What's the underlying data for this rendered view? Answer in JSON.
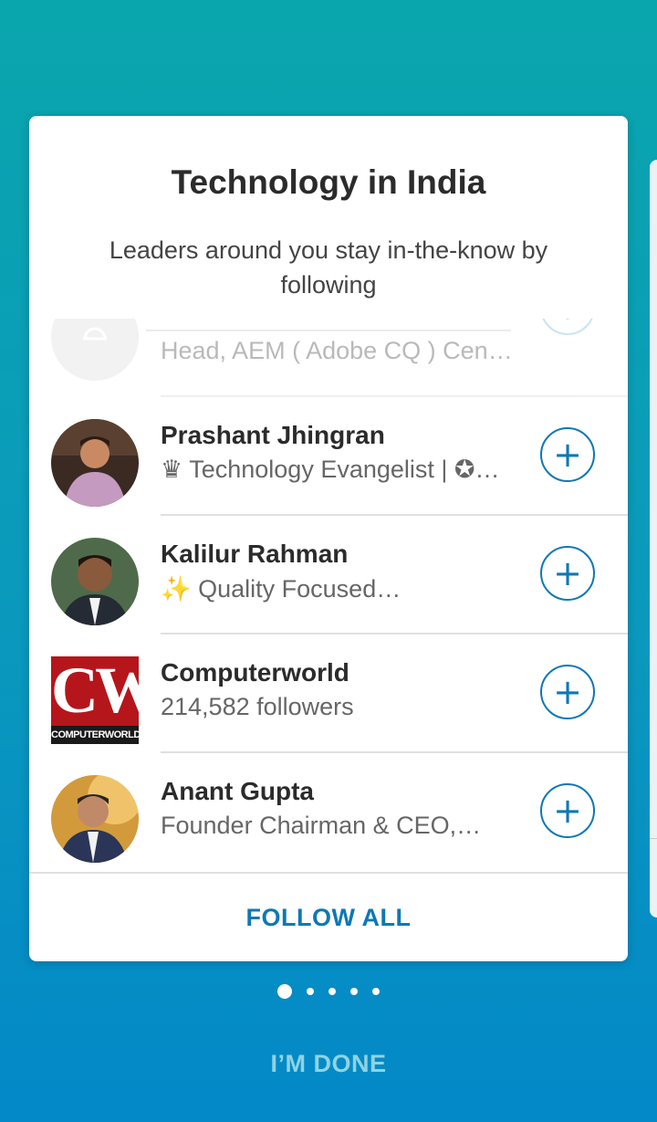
{
  "header": {
    "title": "Technology in India",
    "subtitle": "Leaders around you stay in-the-know by following"
  },
  "people": [
    {
      "name": "",
      "detail": "Head, AEM ( Adobe CQ ) Cent…",
      "avatar": "placeholder-avatar",
      "follow_icon": "+"
    },
    {
      "name": "Prashant Jhingran",
      "detail": "♛ Technology Evangelist | ✪…",
      "avatar": "person-photo",
      "follow_icon": "+"
    },
    {
      "name": "Kalilur Rahman",
      "detail": "✨ Quality Focused…",
      "avatar": "person-photo",
      "follow_icon": "+"
    },
    {
      "name": "Computerworld",
      "detail": "214,582 followers",
      "avatar": "computerworld-logo",
      "logo_text": "CW",
      "logo_caption": "COMPUTERWORLD",
      "follow_icon": "+"
    },
    {
      "name": "Anant Gupta",
      "detail": "Founder Chairman & CEO,…",
      "avatar": "person-photo",
      "follow_icon": "+"
    }
  ],
  "actions": {
    "follow_all": "FOLLOW ALL",
    "done": "I’M DONE"
  },
  "pagination": {
    "current": 1,
    "total": 5
  },
  "colors": {
    "accent": "#0e78b5",
    "logo_red": "#b5161b"
  }
}
